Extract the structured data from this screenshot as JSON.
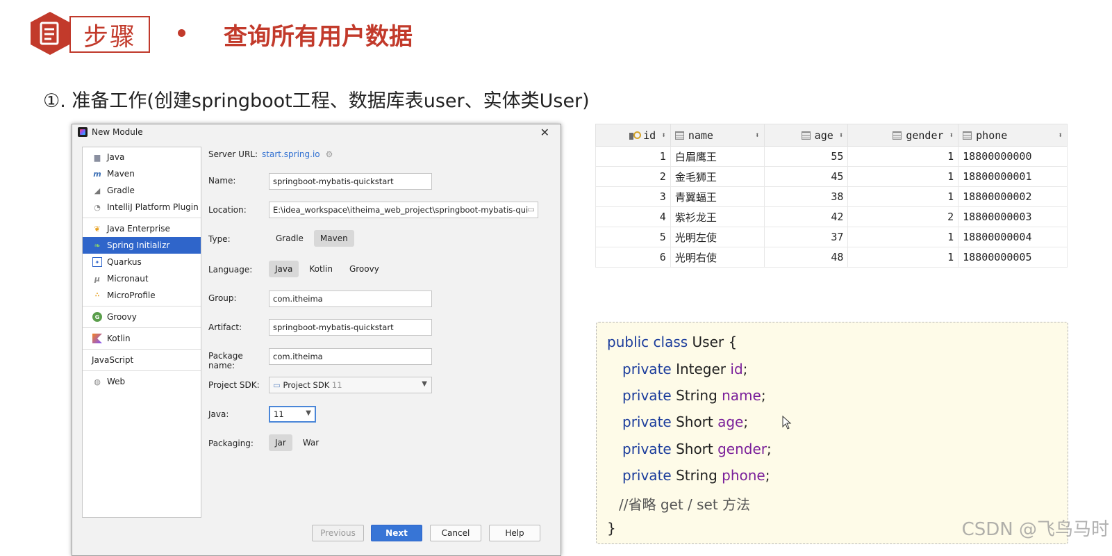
{
  "header": {
    "steps_label": "步骤",
    "title": "查询所有用户数据",
    "accent_color": "#c23a2b"
  },
  "subtitle": "①. 准备工作(创建springboot工程、数据库表user、实体类User)",
  "dialog": {
    "title": "New Module",
    "close_icon": "close-icon",
    "sidebar": {
      "items": [
        {
          "label": "Java",
          "icon": "folder-icon"
        },
        {
          "label": "Maven",
          "icon": "maven-icon"
        },
        {
          "label": "Gradle",
          "icon": "gradle-icon"
        },
        {
          "label": "IntelliJ Platform Plugin",
          "icon": "plugin-icon"
        },
        {
          "label": "Java Enterprise",
          "icon": "java-enterprise-icon"
        },
        {
          "label": "Spring Initializr",
          "icon": "spring-icon",
          "selected": true
        },
        {
          "label": "Quarkus",
          "icon": "quarkus-icon"
        },
        {
          "label": "Micronaut",
          "icon": "micronaut-icon"
        },
        {
          "label": "MicroProfile",
          "icon": "microprofile-icon"
        },
        {
          "label": "Groovy",
          "icon": "groovy-icon"
        },
        {
          "label": "Kotlin",
          "icon": "kotlin-icon"
        },
        {
          "label": "JavaScript",
          "icon": ""
        },
        {
          "label": "Web",
          "icon": "web-icon"
        }
      ]
    },
    "form": {
      "server_url_label": "Server URL:",
      "server_url_value": "start.spring.io",
      "name_label": "Name:",
      "name_value": "springboot-mybatis-quickstart",
      "location_label": "Location:",
      "location_value": "E:\\idea_workspace\\itheima_web_project\\springboot-mybatis-qui",
      "type_label": "Type:",
      "type_options": [
        "Gradle",
        "Maven"
      ],
      "type_selected": "Maven",
      "language_label": "Language:",
      "language_options": [
        "Java",
        "Kotlin",
        "Groovy"
      ],
      "language_selected": "Java",
      "group_label": "Group:",
      "group_value": "com.itheima",
      "artifact_label": "Artifact:",
      "artifact_value": "springboot-mybatis-quickstart",
      "package_label": "Package name:",
      "package_value": "com.itheima",
      "sdk_label": "Project SDK:",
      "sdk_value": "Project SDK",
      "sdk_version": "11",
      "java_label": "Java:",
      "java_value": "11",
      "packaging_label": "Packaging:",
      "packaging_options": [
        "Jar",
        "War"
      ],
      "packaging_selected": "Jar"
    },
    "buttons": {
      "previous": "Previous",
      "next": "Next",
      "cancel": "Cancel",
      "help": "Help"
    }
  },
  "user_table": {
    "columns": [
      "id",
      "name",
      "age",
      "gender",
      "phone"
    ],
    "rows": [
      [
        "1",
        "白眉鹰王",
        "55",
        "1",
        "18800000000"
      ],
      [
        "2",
        "金毛狮王",
        "45",
        "1",
        "18800000001"
      ],
      [
        "3",
        "青翼蝠王",
        "38",
        "1",
        "18800000002"
      ],
      [
        "4",
        "紫衫龙王",
        "42",
        "2",
        "18800000003"
      ],
      [
        "5",
        "光明左使",
        "37",
        "1",
        "18800000004"
      ],
      [
        "6",
        "光明右使",
        "48",
        "1",
        "18800000005"
      ]
    ]
  },
  "code": {
    "class_keyword": "public class",
    "class_name": "User {",
    "fields": [
      {
        "modifier": "private",
        "type": "Integer",
        "name": "id",
        "end": ";"
      },
      {
        "modifier": "private",
        "type": "String",
        "name": "name",
        "end": ";"
      },
      {
        "modifier": "private",
        "type": "Short",
        "name": "age",
        "end": ";"
      },
      {
        "modifier": "private",
        "type": "Short",
        "name": "gender",
        "end": ";"
      },
      {
        "modifier": "private",
        "type": "String",
        "name": "phone",
        "end": ";"
      }
    ],
    "comment": "//省略 get / set 方法",
    "closing": "}"
  },
  "watermark": "CSDN @飞鸟马时"
}
